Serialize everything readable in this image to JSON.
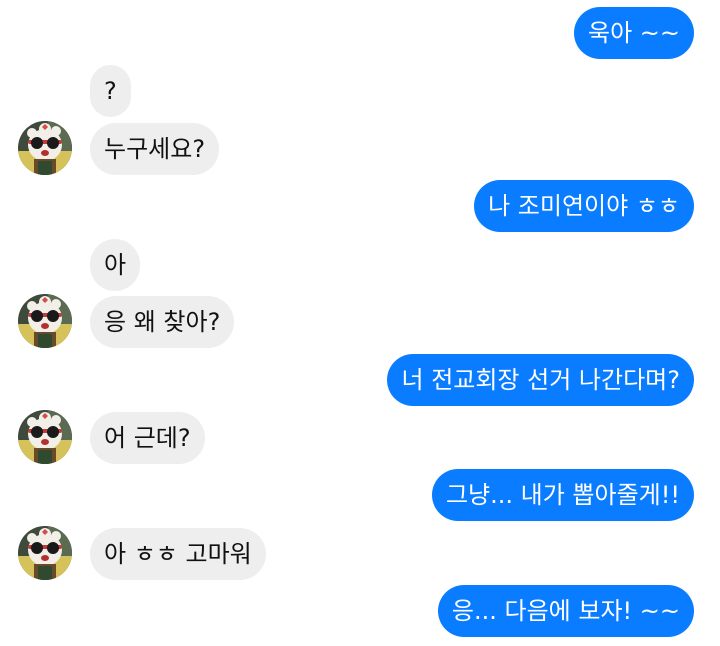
{
  "theme": {
    "outgoing_bubble_color": "#0a7cff",
    "incoming_bubble_color": "#eeeeee",
    "avatar_icon": "cartoon-character-with-sunglasses"
  },
  "messages": [
    {
      "sender": "me",
      "text": "욱아 ~~"
    },
    {
      "sender": "other",
      "text": "?"
    },
    {
      "sender": "other",
      "text": "누구세요?"
    },
    {
      "sender": "me",
      "text": "나 조미연이야 ㅎㅎ"
    },
    {
      "sender": "other",
      "text": "아"
    },
    {
      "sender": "other",
      "text": "응 왜 찾아?"
    },
    {
      "sender": "me",
      "text": "너 전교회장 선거 나간다며?"
    },
    {
      "sender": "other",
      "text": "어 근데?"
    },
    {
      "sender": "me",
      "text": "그냥... 내가 뽑아줄게!!"
    },
    {
      "sender": "other",
      "text": "아 ㅎㅎ 고마워"
    },
    {
      "sender": "me",
      "text": "응... 다음에 보자! ~~"
    }
  ]
}
